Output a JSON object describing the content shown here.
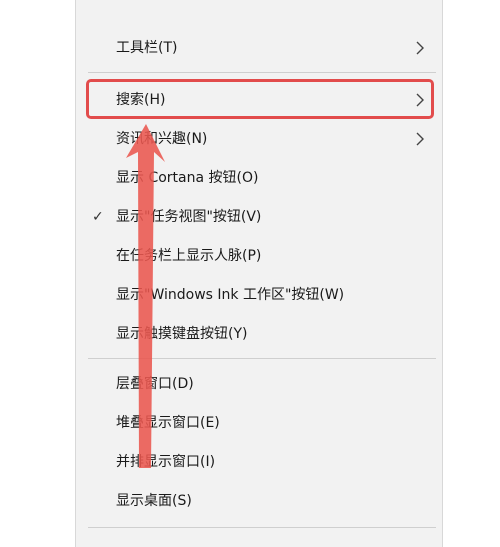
{
  "menu": {
    "items": [
      {
        "label": "工具栏(T)",
        "has_submenu": true
      },
      {
        "label": "搜索(H)",
        "has_submenu": true,
        "highlighted": true
      },
      {
        "label": "资讯和兴趣(N)",
        "has_submenu": true
      },
      {
        "label": "显示 Cortana 按钮(O)"
      },
      {
        "label": "显示\"任务视图\"按钮(V)",
        "checked": true,
        "check_glyph": "✓"
      },
      {
        "label": "在任务栏上显示人脉(P)"
      },
      {
        "label": "显示\"Windows Ink 工作区\"按钮(W)"
      },
      {
        "label": "显示触摸键盘按钮(Y)"
      },
      {
        "label": "层叠窗口(D)"
      },
      {
        "label": "堆叠显示窗口(E)"
      },
      {
        "label": "并排显示窗口(I)"
      },
      {
        "label": "显示桌面(S)"
      }
    ]
  },
  "colors": {
    "menu_bg": "#f2f2f2",
    "highlight_border": "#e24c4c",
    "arrow": "#e9574f",
    "separator": "#cfcfcf"
  },
  "icons": {
    "submenu": "chevron-right-icon",
    "checkmark": "checkmark-icon",
    "annotation": "red-arrow-annotation"
  }
}
